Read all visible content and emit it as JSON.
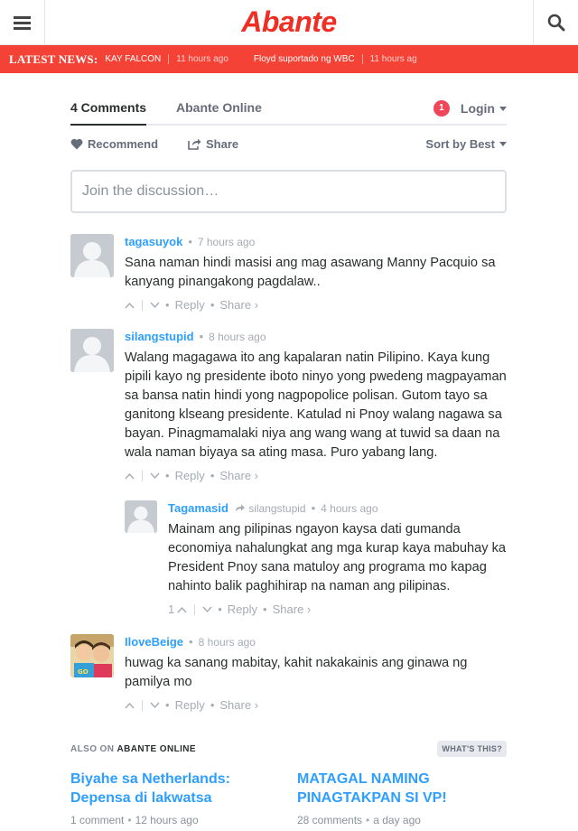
{
  "site": {
    "logo_text": "Abante",
    "brand_color": "#ef2e24"
  },
  "ticker": {
    "label": "LATEST NEWS:",
    "bg_color": "#f44336",
    "items": [
      {
        "title": "KAY FALCON",
        "time": "11 hours ago"
      },
      {
        "title": "Floyd suportado ng WBC",
        "time": "11 hours ag"
      }
    ]
  },
  "disqus": {
    "tabs": {
      "comments": "4 Comments",
      "site": "Abante Online"
    },
    "notification_count": "1",
    "login": "Login",
    "recommend": "Recommend",
    "share": "Share",
    "sort": "Sort by Best",
    "placeholder": "Join the discussion…",
    "accent": "#2e9fff"
  },
  "comments": [
    {
      "author": "tagasuyok",
      "time": "7 hours ago",
      "text": "Sana naman hindi masisi ang mag asawang Manny Pacquio sa kanyang pinangakong pagdalaw..",
      "upvotes": "",
      "reply": "Reply",
      "share": "Share ›"
    },
    {
      "author": "silangstupid",
      "time": "8 hours ago",
      "text": "Walang magagawa ito ang kapalaran natin Pilipino. Kaya kung pipili kayo ng presidente iboto ninyo yong pwedeng magpayaman sa bansa natin hindi yong nagpopolice polisan. Gutom tayo sa ganitong klseang presidente. Katulad ni Pnoy walang nagawa sa bayan. Pinagmamalaki niya ang wang wang at tuwid sa daan na wala naman biyaya sa ating masa. Puro yabang lang.",
      "upvotes": "",
      "reply": "Reply",
      "share": "Share ›"
    },
    {
      "author": "Tagamasid",
      "reply_to": "silangstupid",
      "time": "4 hours ago",
      "text": "Mainam ang pilipinas ngayon kaysa dati gumanda economiya nahalungkat ang mga kurap kaya mabuhay ka President Pnoy sana matuloy ang programa mo kapag nahinto balik paghihirap na naman ang pilipinas.",
      "upvotes": "1",
      "reply": "Reply",
      "share": "Share ›"
    },
    {
      "author": "IloveBeige",
      "time": "8 hours ago",
      "text": "huwag ka sanang mabitay, kahit nakakainis ang ginawa ng pamilya mo",
      "upvotes": "",
      "reply": "Reply",
      "share": "Share ›"
    }
  ],
  "also_on": {
    "prefix": "ALSO ON",
    "site": "ABANTE ONLINE",
    "whats_this": "WHAT'S THIS?",
    "items": [
      {
        "title": "Biyahe sa Netherlands: Depensa di lakwatsa",
        "comments": "1 comment",
        "time": "12 hours ago"
      },
      {
        "title": "MATAGAL NAMING PINAGTAKPAN SI VP!",
        "comments": "28 comments",
        "time": "a day ago"
      }
    ]
  }
}
